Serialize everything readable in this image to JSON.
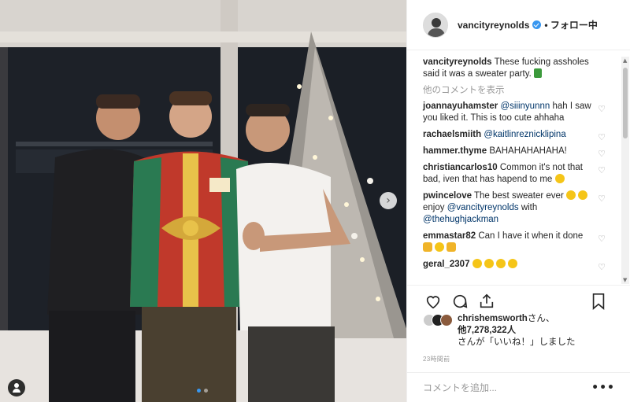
{
  "header": {
    "username": "vancityreynolds",
    "follow_label": "• フォロー中"
  },
  "caption": {
    "username": "vancityreynolds",
    "text": "These fucking assholes said it was a sweater party."
  },
  "view_more_label": "他のコメントを表示",
  "comments": [
    {
      "username": "joannayuhamster",
      "mention": "@siiinyunnn",
      "text": " hah I saw you liked it. This is too cute ahhaha"
    },
    {
      "username": "rachaelsmiith",
      "mention": "@kaitlinreznicklipina",
      "text": ""
    },
    {
      "username": "hammer.thyme",
      "mention": "",
      "text": "BAHAHAHAHAHA!"
    },
    {
      "username": "christiancarlos10",
      "mention": "",
      "text": "Common it's not that bad, iven that has hapend to me"
    },
    {
      "username": "pwincelove",
      "text_a": "The best sweater ever",
      "text_b": " enjoy ",
      "mention_a": "@vancityreynolds",
      "text_c": " with ",
      "mention_b": "@thehughjackman"
    },
    {
      "username": "emmastar82",
      "mention": "",
      "text": "Can I have it when it done"
    },
    {
      "username": "geral_2307",
      "mention": "",
      "text": ""
    }
  ],
  "likes": {
    "first_user": "chrishemsworth",
    "line1_suffix": "さん、",
    "line2": "他7,278,322人",
    "line3": "さんが「いいね！」しました"
  },
  "timestamp": "23時間前",
  "comment_input": {
    "placeholder": "コメントを追加..."
  },
  "more_options": "•••",
  "icons": {
    "like": "heart-outline-icon",
    "comment": "speech-bubble-icon",
    "share": "share-upload-icon",
    "save": "bookmark-icon",
    "verified": "verified-badge-icon"
  },
  "colors": {
    "verified_blue": "#3897f0",
    "mention_blue": "#003569",
    "muted_text": "#999999"
  }
}
